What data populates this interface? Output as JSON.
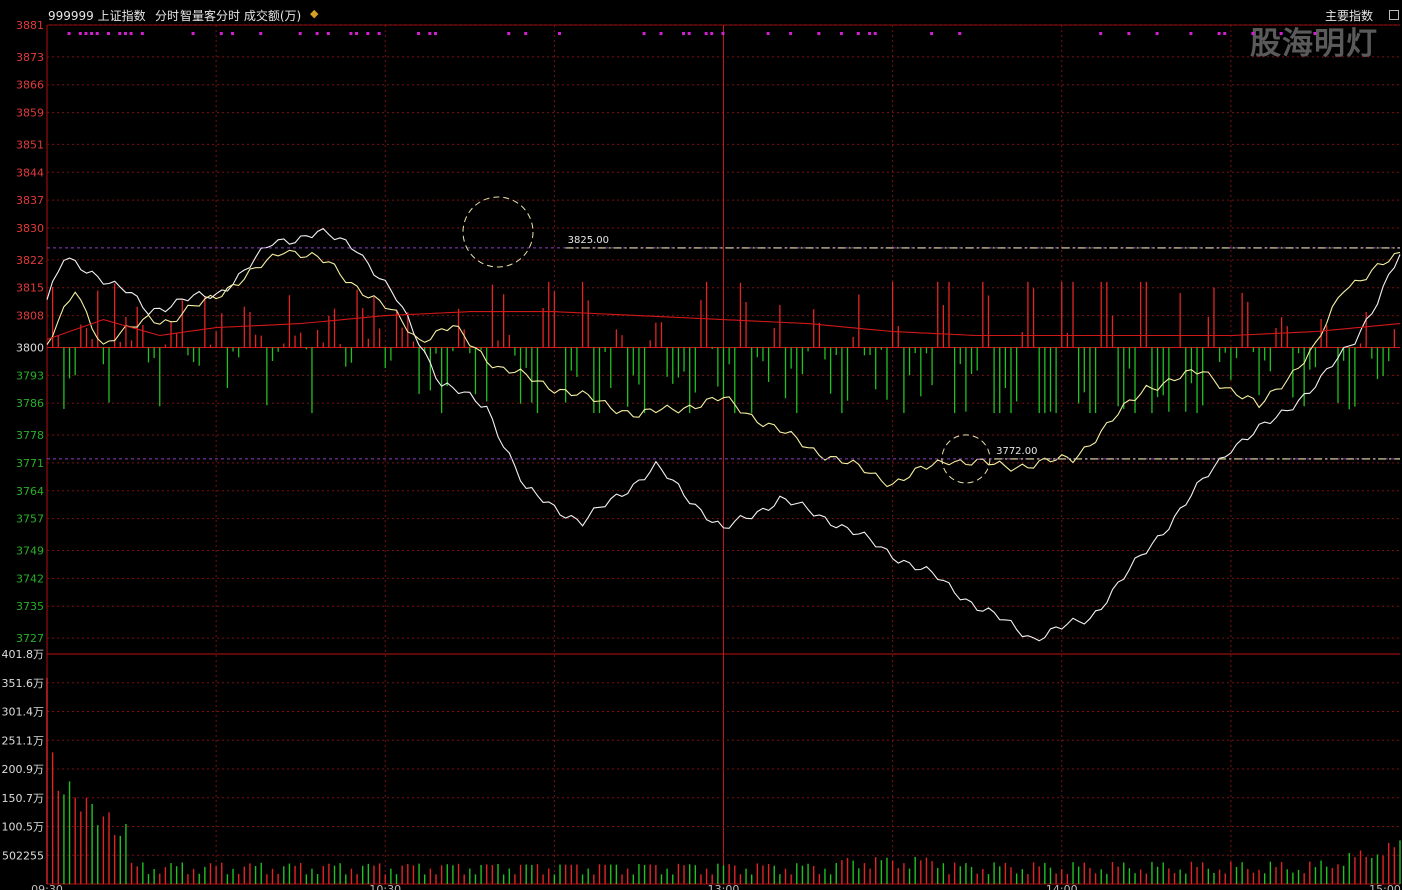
{
  "header": {
    "code_name": "999999 上证指数",
    "mode": "分时",
    "indicator": "智量客分时 成交额(万)",
    "position_icon": "position-marker-icon",
    "right_label": "主要指数",
    "watermark": "股海明灯"
  },
  "chart_data": {
    "type": "line",
    "title": "",
    "time_ticks": [
      "09:30",
      "10:30",
      "13:00",
      "14:00",
      "15:00"
    ],
    "price_ticks": [
      "3881",
      "3873",
      "3866",
      "3859",
      "3851",
      "3844",
      "3837",
      "3830",
      "3822",
      "3815",
      "3808",
      "3800",
      "3793",
      "3786",
      "3778",
      "3771",
      "3764",
      "3757",
      "3749",
      "3742",
      "3735",
      "3727"
    ],
    "ylim": [
      3723,
      3881
    ],
    "prev_close": 3800,
    "annotations": [
      {
        "label": "3825.00",
        "value": 3825
      },
      {
        "label": "3772.00",
        "value": 3772
      }
    ],
    "volume_ticks": [
      "401.8万",
      "351.6万",
      "301.4万",
      "251.1万",
      "200.9万",
      "150.7万",
      "100.5万",
      "502255"
    ],
    "volume_ylim": [
      0,
      401.8
    ],
    "series": [
      {
        "role": "index",
        "x": [
          0,
          3,
          8,
          14,
          18,
          24,
          30,
          40,
          48,
          55,
          62,
          70,
          78,
          85,
          95,
          108,
          120,
          130,
          140,
          150,
          158,
          165,
          175,
          185,
          198,
          210,
          218,
          226,
          232,
          236,
          240
        ],
        "y": [
          3812,
          3822,
          3819,
          3814,
          3809,
          3812,
          3813,
          3826,
          3829,
          3825,
          3812,
          3791,
          3785,
          3764,
          3756,
          3770,
          3754,
          3762,
          3756,
          3748,
          3742,
          3735,
          3727,
          3732,
          3754,
          3775,
          3782,
          3792,
          3802,
          3812,
          3823
        ]
      },
      {
        "role": "average",
        "x": [
          0,
          5,
          10,
          18,
          22,
          28,
          35,
          42,
          50,
          58,
          62,
          66,
          72,
          80,
          90,
          105,
          120,
          135,
          150,
          160,
          170,
          182,
          195,
          205,
          215,
          225,
          230,
          236,
          240
        ],
        "y": [
          3800,
          3815,
          3800,
          3808,
          3806,
          3812,
          3817,
          3825,
          3821,
          3812,
          3808,
          3802,
          3805,
          3795,
          3790,
          3783,
          3787,
          3775,
          3766,
          3772,
          3770,
          3772,
          3790,
          3794,
          3785,
          3800,
          3815,
          3820,
          3823
        ]
      },
      {
        "role": "ma",
        "x": [
          0,
          10,
          20,
          30,
          45,
          60,
          75,
          90,
          105,
          120,
          135,
          150,
          165,
          180,
          195,
          210,
          225,
          240
        ],
        "y": [
          3802,
          3807,
          3803,
          3805,
          3806,
          3808,
          3809,
          3809,
          3808,
          3807,
          3806,
          3804,
          3803,
          3803,
          3803,
          3803,
          3804,
          3806
        ]
      }
    ]
  }
}
